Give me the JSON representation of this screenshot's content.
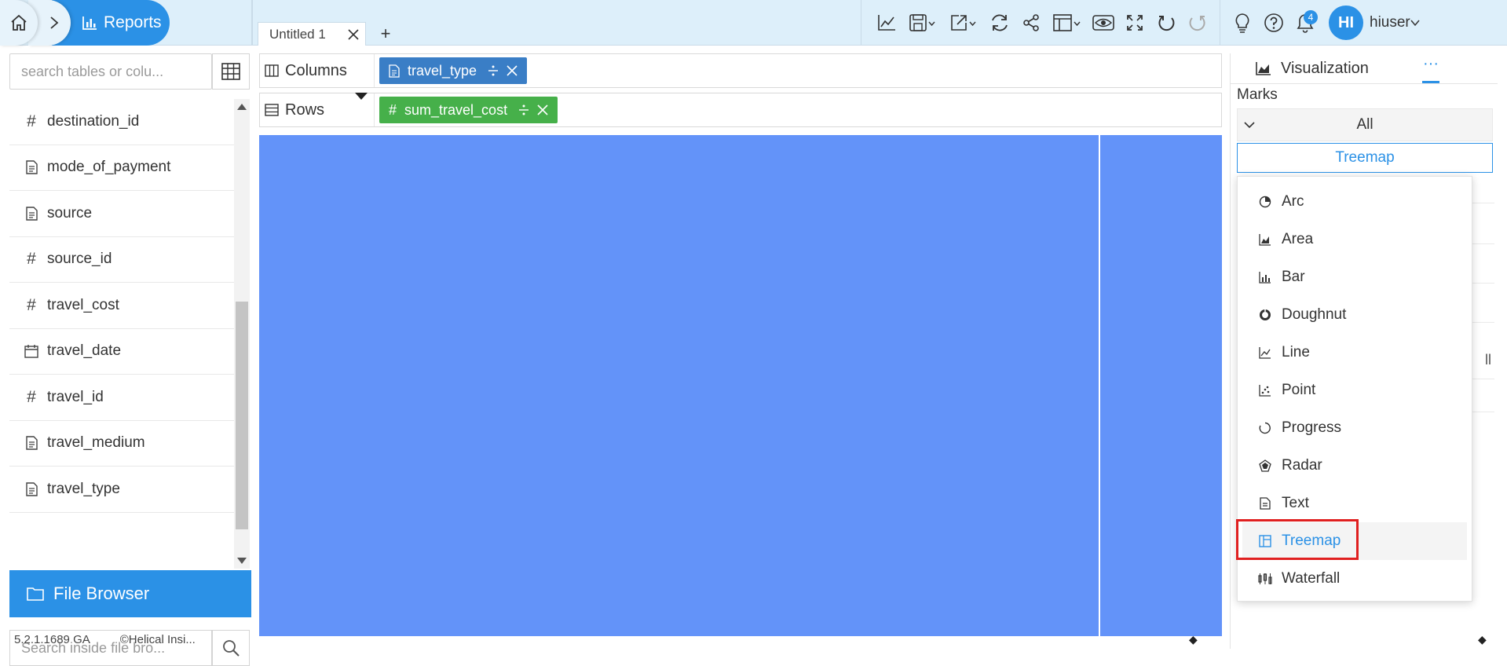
{
  "breadcrumb": {
    "home_icon": "home-icon",
    "next_icon": "chevron-right-icon",
    "reports_label": "Reports",
    "reports_icon": "bar-chart-icon"
  },
  "tabs": {
    "items": [
      {
        "label": "Untitled 1"
      }
    ],
    "add_label": "+"
  },
  "toolbar": {
    "icons": [
      "line-chart-icon",
      "save-icon",
      "export-icon",
      "refresh-icon",
      "share-icon",
      "layout-icon",
      "preview-icon",
      "fullscreen-icon",
      "undo-icon",
      "redo-icon"
    ],
    "notification_count": "4",
    "user_initials": "HI",
    "user_name": "hiuser"
  },
  "sidebar": {
    "search_placeholder": "search tables or colu...",
    "fields": [
      {
        "name": "destination_id",
        "type": "number"
      },
      {
        "name": "mode_of_payment",
        "type": "text"
      },
      {
        "name": "source",
        "type": "text"
      },
      {
        "name": "source_id",
        "type": "number"
      },
      {
        "name": "travel_cost",
        "type": "number"
      },
      {
        "name": "travel_date",
        "type": "date"
      },
      {
        "name": "travel_id",
        "type": "number"
      },
      {
        "name": "travel_medium",
        "type": "text"
      },
      {
        "name": "travel_type",
        "type": "text"
      }
    ],
    "file_browser_label": "File Browser",
    "file_search_placeholder": "Search inside file bro..."
  },
  "footer": {
    "version": "5.2.1.1689 GA",
    "copyright": "©Helical Insi..."
  },
  "shelves": {
    "columns_label": "Columns",
    "rows_label": "Rows",
    "columns_pill": "travel_type",
    "rows_pill": "sum_travel_cost"
  },
  "right_panel": {
    "visualization_label": "Visualization",
    "more_label": "···",
    "marks_label": "Marks",
    "marks_scope": "All",
    "selected_chart": "Treemap",
    "partial_text": "ll"
  },
  "chart_menu": {
    "items": [
      {
        "label": "Arc",
        "icon": "arc-icon"
      },
      {
        "label": "Area",
        "icon": "area-chart-icon"
      },
      {
        "label": "Bar",
        "icon": "bar-chart-icon"
      },
      {
        "label": "Doughnut",
        "icon": "doughnut-icon"
      },
      {
        "label": "Line",
        "icon": "line-chart-icon"
      },
      {
        "label": "Point",
        "icon": "scatter-icon"
      },
      {
        "label": "Progress",
        "icon": "progress-icon"
      },
      {
        "label": "Radar",
        "icon": "radar-icon"
      },
      {
        "label": "Text",
        "icon": "text-icon"
      },
      {
        "label": "Treemap",
        "icon": "treemap-icon",
        "active": true
      },
      {
        "label": "Waterfall",
        "icon": "waterfall-icon"
      }
    ]
  },
  "colors": {
    "accent": "#2b91e6",
    "treemap_fill": "#6393f9",
    "column_pill": "#3a7ec6",
    "row_pill": "#46b04a",
    "highlight": "#e02020"
  }
}
